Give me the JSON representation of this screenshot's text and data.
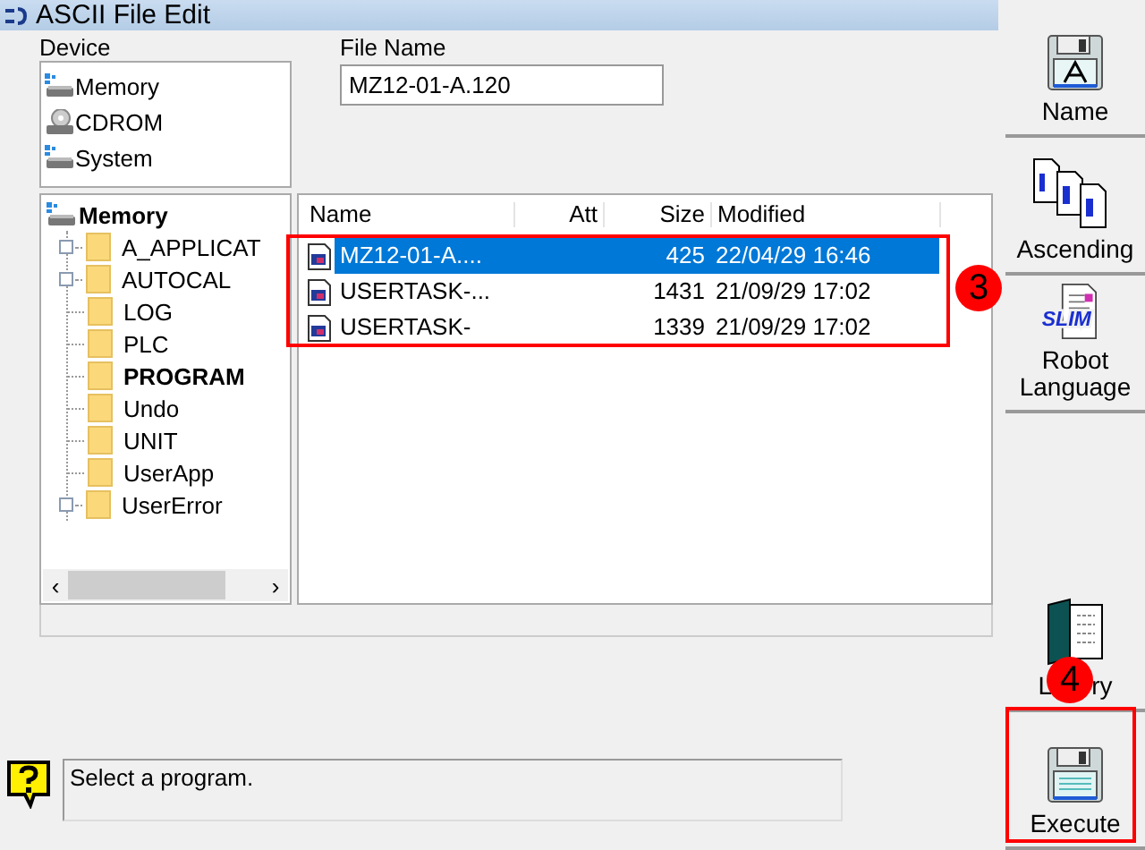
{
  "window": {
    "title": "ASCII File Edit"
  },
  "device": {
    "label": "Device",
    "items": [
      {
        "name": "Memory",
        "kind": "drive"
      },
      {
        "name": "CDROM",
        "kind": "cdrom"
      },
      {
        "name": "System",
        "kind": "drive"
      }
    ]
  },
  "file_name": {
    "label": "File Name",
    "value": "MZ12-01-A.120"
  },
  "tree": {
    "label": "Memory",
    "children": [
      {
        "label": "A_APPLICAT",
        "expandable": true,
        "selected": false
      },
      {
        "label": "AUTOCAL",
        "expandable": true,
        "selected": false
      },
      {
        "label": "LOG",
        "expandable": false,
        "selected": false
      },
      {
        "label": "PLC",
        "expandable": false,
        "selected": false
      },
      {
        "label": "PROGRAM",
        "expandable": false,
        "selected": true
      },
      {
        "label": "Undo",
        "expandable": false,
        "selected": false
      },
      {
        "label": "UNIT",
        "expandable": false,
        "selected": false
      },
      {
        "label": "UserApp",
        "expandable": false,
        "selected": false
      },
      {
        "label": "UserError",
        "expandable": true,
        "selected": false
      }
    ]
  },
  "file_list": {
    "columns": [
      "Name",
      "Att",
      "Size",
      "Modified"
    ],
    "rows": [
      {
        "name": "MZ12-01-A....",
        "size": "425",
        "modified": "22/04/29 16:46",
        "selected": true
      },
      {
        "name": "USERTASK-...",
        "size": "1431",
        "modified": "21/09/29 17:02",
        "selected": false
      },
      {
        "name": "USERTASK-",
        "size": "1339",
        "modified": "21/09/29 17:02",
        "selected": false
      }
    ]
  },
  "message": "Select a program.",
  "toolbar_top": [
    {
      "label": "Name",
      "kind": "name"
    },
    {
      "label": "Ascending",
      "kind": "ascending"
    },
    {
      "label": "Robot Language",
      "kind": "language",
      "icon_text": "SLIM"
    }
  ],
  "toolbar_bottom": [
    {
      "label_left": "L",
      "label_right": "ry",
      "kind": "library"
    },
    {
      "label": "Execute",
      "kind": "execute"
    }
  ],
  "annotations": [
    {
      "number": "3"
    },
    {
      "number": "4"
    }
  ],
  "tree_scrollbar": {
    "left": "‹",
    "right": "›"
  }
}
